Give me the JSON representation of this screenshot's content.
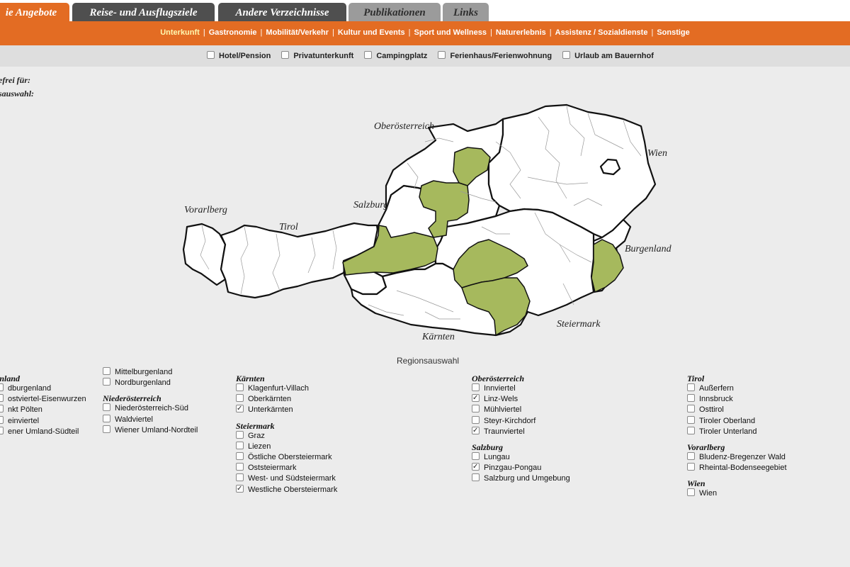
{
  "tabs": [
    {
      "label": "ie Angebote"
    },
    {
      "label": "Reise- und Ausflugsziele"
    },
    {
      "label": "Andere Verzeichnisse"
    },
    {
      "label": "Publikationen"
    },
    {
      "label": "Links"
    }
  ],
  "subnav": {
    "items": [
      "Unterkunft",
      "Gastronomie",
      "Mobilität/Verkehr",
      "Kultur und Events",
      "Sport und Wellness",
      "Naturerlebnis",
      "Assistenz / Sozialdienste",
      "Sonstige"
    ],
    "selected": "Unterkunft",
    "separator": "|"
  },
  "filters": [
    "Hotel/Pension",
    "Privatunterkunft",
    "Campingplatz",
    "Ferienhaus/Ferienwohnung",
    "Urlaub am Bauernhof"
  ],
  "left_labels": [
    "efrei für:",
    "sauswahl:"
  ],
  "map": {
    "labels": [
      "Oberösterreich",
      "Wien",
      "Vorarlberg",
      "Tirol",
      "Salzburg",
      "Burgenland",
      "Steiermark",
      "Kärnten"
    ],
    "fill_selected": "#a6b95d",
    "fill_default": "#ffffff",
    "stroke": "#111111"
  },
  "regions_title": "Regionsauswahl",
  "colors": {
    "accent": "#e36c23",
    "tab_dark": "#4f4f4f",
    "tab_light": "#9b9b9b",
    "background": "#ececec"
  },
  "columns": [
    {
      "groups": [
        {
          "title": "enland",
          "items": [
            {
              "label": "dburgenland",
              "checked": false
            },
            {
              "label": "ostviertel-Eisenwurzen",
              "checked": false
            },
            {
              "label": "nkt Pölten",
              "checked": false
            },
            {
              "label": "einviertel",
              "checked": false
            },
            {
              "label": "ener Umland-Südteil",
              "checked": false
            }
          ]
        }
      ]
    },
    {
      "groups": [
        {
          "title": "",
          "items": [
            {
              "label": "Mittelburgenland",
              "checked": false
            },
            {
              "label": "Nordburgenland",
              "checked": false
            }
          ]
        },
        {
          "title": "Niederösterreich",
          "items": [
            {
              "label": "Niederösterreich-Süd",
              "checked": false
            },
            {
              "label": "Waldviertel",
              "checked": false
            },
            {
              "label": "Wiener Umland-Nordteil",
              "checked": false
            }
          ]
        }
      ]
    },
    {
      "groups": [
        {
          "title": "Kärnten",
          "items": [
            {
              "label": "Klagenfurt-Villach",
              "checked": false
            },
            {
              "label": "Oberkärnten",
              "checked": false
            },
            {
              "label": "Unterkärnten",
              "checked": true
            }
          ]
        },
        {
          "title": "Steiermark",
          "items": [
            {
              "label": "Graz",
              "checked": false
            },
            {
              "label": "Liezen",
              "checked": false
            },
            {
              "label": "Östliche Obersteiermark",
              "checked": false
            },
            {
              "label": "Oststeiermark",
              "checked": false
            },
            {
              "label": "West- und Südsteiermark",
              "checked": false
            },
            {
              "label": "Westliche Obersteiermark",
              "checked": true
            }
          ]
        }
      ]
    },
    {
      "groups": [
        {
          "title": "Oberösterreich",
          "items": [
            {
              "label": "Innviertel",
              "checked": false
            },
            {
              "label": "Linz-Wels",
              "checked": true
            },
            {
              "label": "Mühlviertel",
              "checked": false
            },
            {
              "label": "Steyr-Kirchdorf",
              "checked": false
            },
            {
              "label": "Traunviertel",
              "checked": true
            }
          ]
        },
        {
          "title": "Salzburg",
          "items": [
            {
              "label": "Lungau",
              "checked": false
            },
            {
              "label": "Pinzgau-Pongau",
              "checked": true
            },
            {
              "label": "Salzburg und Umgebung",
              "checked": false
            }
          ]
        }
      ]
    },
    {
      "groups": [
        {
          "title": "Tirol",
          "items": [
            {
              "label": "Außerfern",
              "checked": false
            },
            {
              "label": "Innsbruck",
              "checked": false
            },
            {
              "label": "Osttirol",
              "checked": false
            },
            {
              "label": "Tiroler Oberland",
              "checked": false
            },
            {
              "label": "Tiroler Unterland",
              "checked": false
            }
          ]
        },
        {
          "title": "Vorarlberg",
          "items": [
            {
              "label": "Bludenz-Bregenzer Wald",
              "checked": false
            },
            {
              "label": "Rheintal-Bodenseegebiet",
              "checked": false
            }
          ]
        },
        {
          "title": "Wien",
          "items": [
            {
              "label": "Wien",
              "checked": false
            }
          ]
        }
      ]
    }
  ]
}
